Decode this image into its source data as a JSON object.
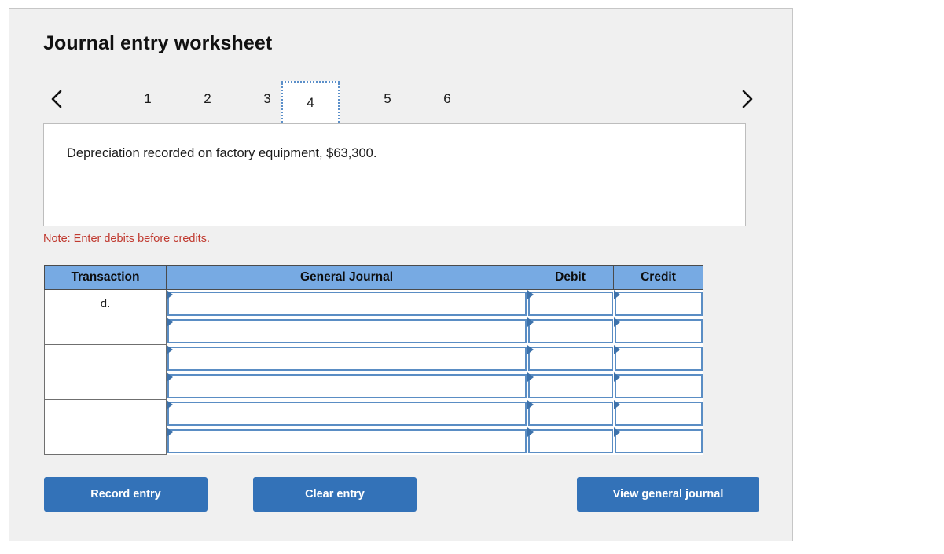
{
  "panel": {
    "title": "Journal entry worksheet"
  },
  "pager": {
    "prev_icon": "chevron-left-icon",
    "next_icon": "chevron-right-icon",
    "pages": [
      "1",
      "2",
      "3",
      "4",
      "5",
      "6"
    ],
    "active_page": "4"
  },
  "description": {
    "text": "Depreciation recorded on factory equipment, $63,300."
  },
  "note": {
    "text": "Note: Enter debits before credits."
  },
  "table": {
    "headers": [
      "Transaction",
      "General Journal",
      "Debit",
      "Credit"
    ],
    "rows": [
      {
        "transaction": "d.",
        "general_journal": "",
        "debit": "",
        "credit": ""
      },
      {
        "transaction": "",
        "general_journal": "",
        "debit": "",
        "credit": ""
      },
      {
        "transaction": "",
        "general_journal": "",
        "debit": "",
        "credit": ""
      },
      {
        "transaction": "",
        "general_journal": "",
        "debit": "",
        "credit": ""
      },
      {
        "transaction": "",
        "general_journal": "",
        "debit": "",
        "credit": ""
      },
      {
        "transaction": "",
        "general_journal": "",
        "debit": "",
        "credit": ""
      }
    ]
  },
  "buttons": {
    "record": "Record entry",
    "clear": "Clear entry",
    "view": "View general journal"
  },
  "colors": {
    "header_blue": "#77aae3",
    "button_blue": "#3372b8",
    "note_red": "#c0392f",
    "input_border_blue": "#5a8dc4",
    "panel_bg": "#f0f0f0"
  }
}
